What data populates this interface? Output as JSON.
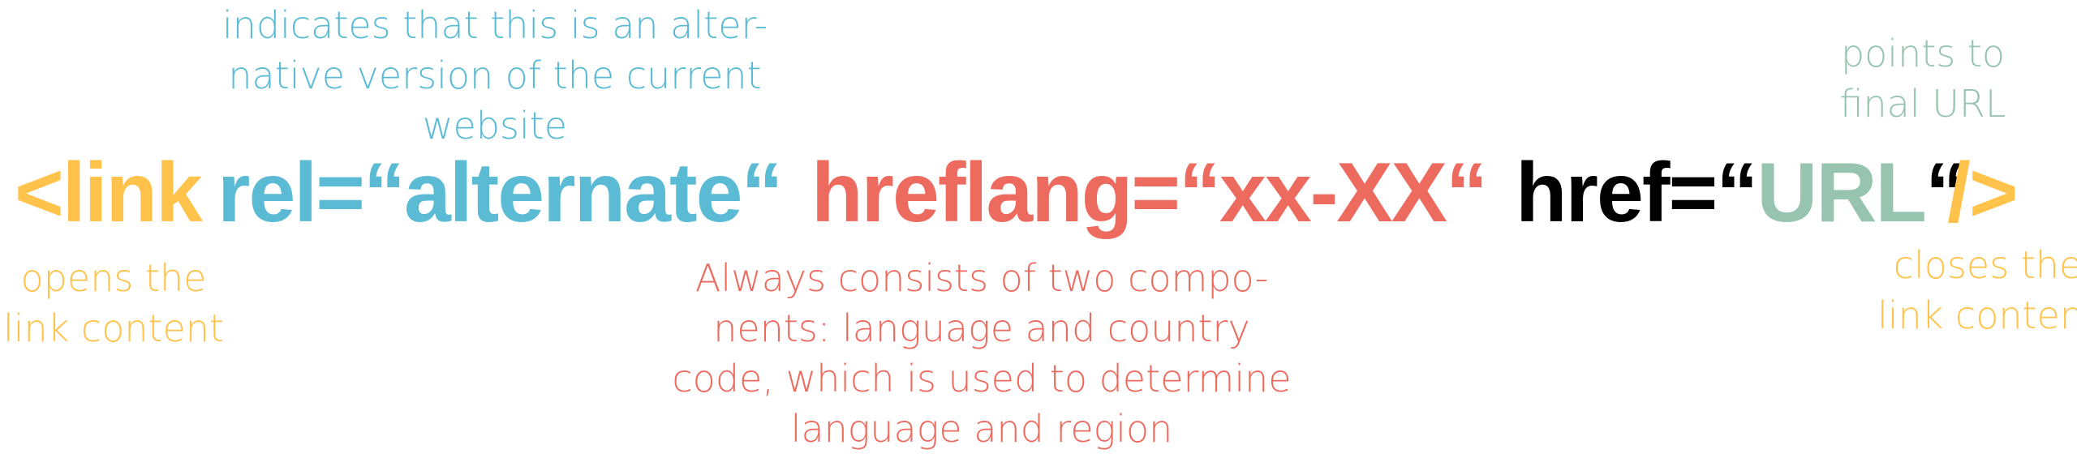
{
  "colors": {
    "yellow": "#FFC24A",
    "blue": "#5BBBD5",
    "red": "#EC6A5E",
    "black": "#000000",
    "green": "#96C4AE"
  },
  "code": {
    "open": "<link",
    "rel": "rel=“alternate“",
    "hreflang": "hreflang=“xx-XX“",
    "href_prefix": "href=“",
    "href_url": "URL",
    "href_suffix": "“",
    "close": "/>"
  },
  "notes": {
    "rel": "indicates that this is an alter-\nnative version of the current\nwebsite",
    "url": "points to\nfinal URL",
    "open": "opens the\nlink content",
    "hreflang": "Always consists of two compo-\nnents: language and country\ncode, which is used to determine\nlanguage and region",
    "close": "closes the\nlink content"
  }
}
